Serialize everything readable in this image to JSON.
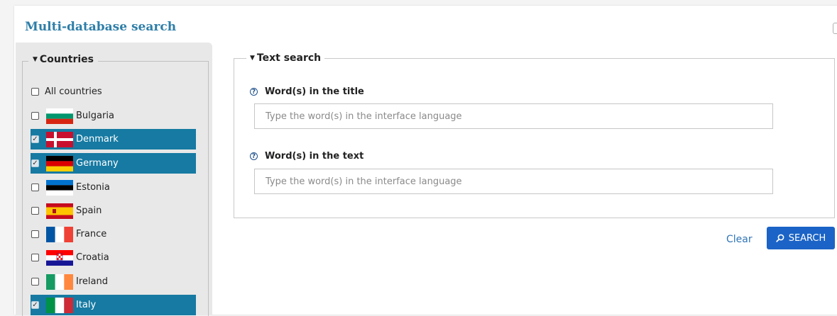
{
  "page": {
    "title": "Multi-database search"
  },
  "countries": {
    "legend": "Countries",
    "all_label": "All countries",
    "items": [
      {
        "name": "Bulgaria",
        "checked": false,
        "flag": "bulgaria-flag-icon"
      },
      {
        "name": "Denmark",
        "checked": true,
        "flag": "denmark-flag-icon"
      },
      {
        "name": "Germany",
        "checked": true,
        "flag": "germany-flag-icon"
      },
      {
        "name": "Estonia",
        "checked": false,
        "flag": "estonia-flag-icon"
      },
      {
        "name": "Spain",
        "checked": false,
        "flag": "spain-flag-icon"
      },
      {
        "name": "France",
        "checked": false,
        "flag": "france-flag-icon"
      },
      {
        "name": "Croatia",
        "checked": false,
        "flag": "croatia-flag-icon"
      },
      {
        "name": "Ireland",
        "checked": false,
        "flag": "ireland-flag-icon"
      },
      {
        "name": "Italy",
        "checked": true,
        "flag": "italy-flag-icon"
      }
    ]
  },
  "text_search": {
    "legend": "Text search",
    "title_field": {
      "label": "Word(s) in the title",
      "placeholder": "Type the word(s) in the interface language",
      "value": ""
    },
    "text_field": {
      "label": "Word(s) in the text",
      "placeholder": "Type the word(s) in the interface language",
      "value": ""
    }
  },
  "actions": {
    "clear_label": "Clear",
    "search_label": "SEARCH"
  },
  "colors": {
    "title": "#2e7ea8",
    "selected_row": "#167aa2",
    "search_button": "#1b63c6",
    "link": "#2f74b8"
  }
}
